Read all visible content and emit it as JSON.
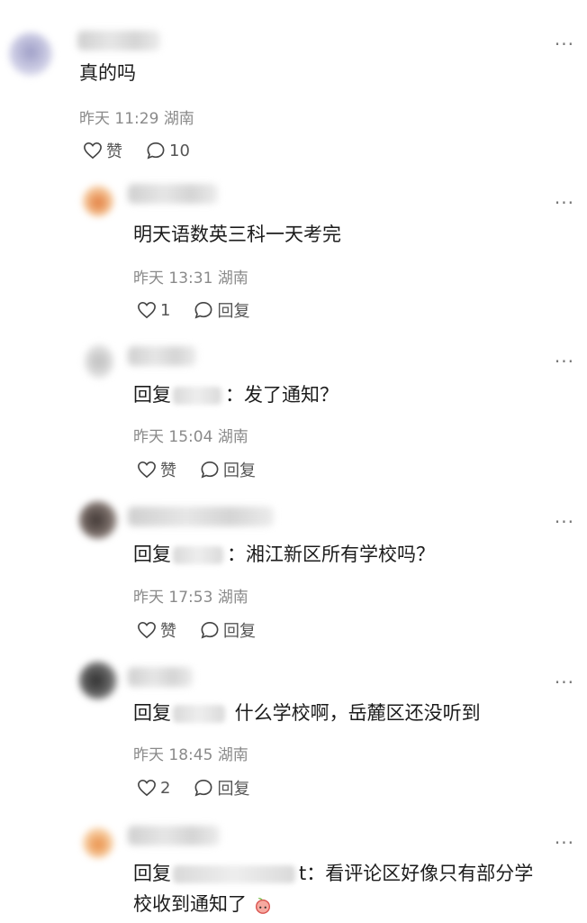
{
  "comments": [
    {
      "text": "真的吗",
      "time": "昨天 11:29",
      "location": "湖南",
      "like_label": "赞",
      "reply_label": "10",
      "avatar_color": "#b9b9d6"
    },
    {
      "text": "明天语数英三科一天考完",
      "time": "昨天 13:31",
      "location": "湖南",
      "like_label": "1",
      "reply_label": "回复",
      "avatar_color": "#e8a56a"
    },
    {
      "reply_prefix": "回复",
      "text": "：发了通知？",
      "time": "昨天 15:04",
      "location": "湖南",
      "like_label": "赞",
      "reply_label": "回复",
      "avatar_color": "#c8c8c8"
    },
    {
      "reply_prefix": "回复",
      "text": "：湘江新区所有学校吗？",
      "time": "昨天 17:53",
      "location": "湖南",
      "like_label": "赞",
      "reply_label": "回复",
      "avatar_color": "#6d625e"
    },
    {
      "reply_prefix": "回复",
      "text": " 什么学校啊，岳麓区还没听到",
      "time": "昨天 18:45",
      "location": "湖南",
      "like_label": "2",
      "reply_label": "回复",
      "avatar_color": "#555555"
    },
    {
      "reply_prefix": "回复",
      "text": "t：看评论区好像只有部分学",
      "text_line2": "校收到通知了",
      "avatar_color": "#f0b37a"
    }
  ],
  "more_label": "···"
}
